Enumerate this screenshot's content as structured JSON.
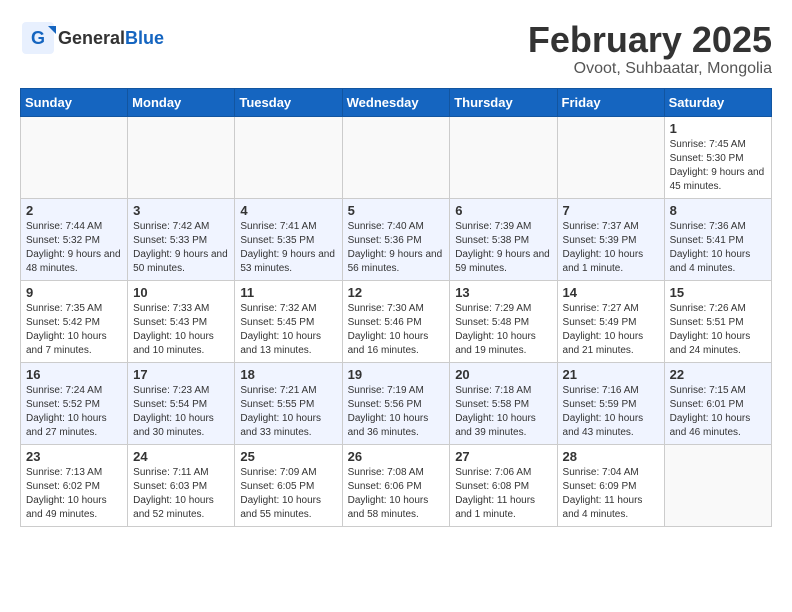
{
  "header": {
    "logo_general": "General",
    "logo_blue": "Blue",
    "month": "February 2025",
    "location": "Ovoot, Suhbaatar, Mongolia"
  },
  "weekdays": [
    "Sunday",
    "Monday",
    "Tuesday",
    "Wednesday",
    "Thursday",
    "Friday",
    "Saturday"
  ],
  "weeks": [
    [
      {
        "day": "",
        "info": ""
      },
      {
        "day": "",
        "info": ""
      },
      {
        "day": "",
        "info": ""
      },
      {
        "day": "",
        "info": ""
      },
      {
        "day": "",
        "info": ""
      },
      {
        "day": "",
        "info": ""
      },
      {
        "day": "1",
        "info": "Sunrise: 7:45 AM\nSunset: 5:30 PM\nDaylight: 9 hours and 45 minutes."
      }
    ],
    [
      {
        "day": "2",
        "info": "Sunrise: 7:44 AM\nSunset: 5:32 PM\nDaylight: 9 hours and 48 minutes."
      },
      {
        "day": "3",
        "info": "Sunrise: 7:42 AM\nSunset: 5:33 PM\nDaylight: 9 hours and 50 minutes."
      },
      {
        "day": "4",
        "info": "Sunrise: 7:41 AM\nSunset: 5:35 PM\nDaylight: 9 hours and 53 minutes."
      },
      {
        "day": "5",
        "info": "Sunrise: 7:40 AM\nSunset: 5:36 PM\nDaylight: 9 hours and 56 minutes."
      },
      {
        "day": "6",
        "info": "Sunrise: 7:39 AM\nSunset: 5:38 PM\nDaylight: 9 hours and 59 minutes."
      },
      {
        "day": "7",
        "info": "Sunrise: 7:37 AM\nSunset: 5:39 PM\nDaylight: 10 hours and 1 minute."
      },
      {
        "day": "8",
        "info": "Sunrise: 7:36 AM\nSunset: 5:41 PM\nDaylight: 10 hours and 4 minutes."
      }
    ],
    [
      {
        "day": "9",
        "info": "Sunrise: 7:35 AM\nSunset: 5:42 PM\nDaylight: 10 hours and 7 minutes."
      },
      {
        "day": "10",
        "info": "Sunrise: 7:33 AM\nSunset: 5:43 PM\nDaylight: 10 hours and 10 minutes."
      },
      {
        "day": "11",
        "info": "Sunrise: 7:32 AM\nSunset: 5:45 PM\nDaylight: 10 hours and 13 minutes."
      },
      {
        "day": "12",
        "info": "Sunrise: 7:30 AM\nSunset: 5:46 PM\nDaylight: 10 hours and 16 minutes."
      },
      {
        "day": "13",
        "info": "Sunrise: 7:29 AM\nSunset: 5:48 PM\nDaylight: 10 hours and 19 minutes."
      },
      {
        "day": "14",
        "info": "Sunrise: 7:27 AM\nSunset: 5:49 PM\nDaylight: 10 hours and 21 minutes."
      },
      {
        "day": "15",
        "info": "Sunrise: 7:26 AM\nSunset: 5:51 PM\nDaylight: 10 hours and 24 minutes."
      }
    ],
    [
      {
        "day": "16",
        "info": "Sunrise: 7:24 AM\nSunset: 5:52 PM\nDaylight: 10 hours and 27 minutes."
      },
      {
        "day": "17",
        "info": "Sunrise: 7:23 AM\nSunset: 5:54 PM\nDaylight: 10 hours and 30 minutes."
      },
      {
        "day": "18",
        "info": "Sunrise: 7:21 AM\nSunset: 5:55 PM\nDaylight: 10 hours and 33 minutes."
      },
      {
        "day": "19",
        "info": "Sunrise: 7:19 AM\nSunset: 5:56 PM\nDaylight: 10 hours and 36 minutes."
      },
      {
        "day": "20",
        "info": "Sunrise: 7:18 AM\nSunset: 5:58 PM\nDaylight: 10 hours and 39 minutes."
      },
      {
        "day": "21",
        "info": "Sunrise: 7:16 AM\nSunset: 5:59 PM\nDaylight: 10 hours and 43 minutes."
      },
      {
        "day": "22",
        "info": "Sunrise: 7:15 AM\nSunset: 6:01 PM\nDaylight: 10 hours and 46 minutes."
      }
    ],
    [
      {
        "day": "23",
        "info": "Sunrise: 7:13 AM\nSunset: 6:02 PM\nDaylight: 10 hours and 49 minutes."
      },
      {
        "day": "24",
        "info": "Sunrise: 7:11 AM\nSunset: 6:03 PM\nDaylight: 10 hours and 52 minutes."
      },
      {
        "day": "25",
        "info": "Sunrise: 7:09 AM\nSunset: 6:05 PM\nDaylight: 10 hours and 55 minutes."
      },
      {
        "day": "26",
        "info": "Sunrise: 7:08 AM\nSunset: 6:06 PM\nDaylight: 10 hours and 58 minutes."
      },
      {
        "day": "27",
        "info": "Sunrise: 7:06 AM\nSunset: 6:08 PM\nDaylight: 11 hours and 1 minute."
      },
      {
        "day": "28",
        "info": "Sunrise: 7:04 AM\nSunset: 6:09 PM\nDaylight: 11 hours and 4 minutes."
      },
      {
        "day": "",
        "info": ""
      }
    ]
  ]
}
